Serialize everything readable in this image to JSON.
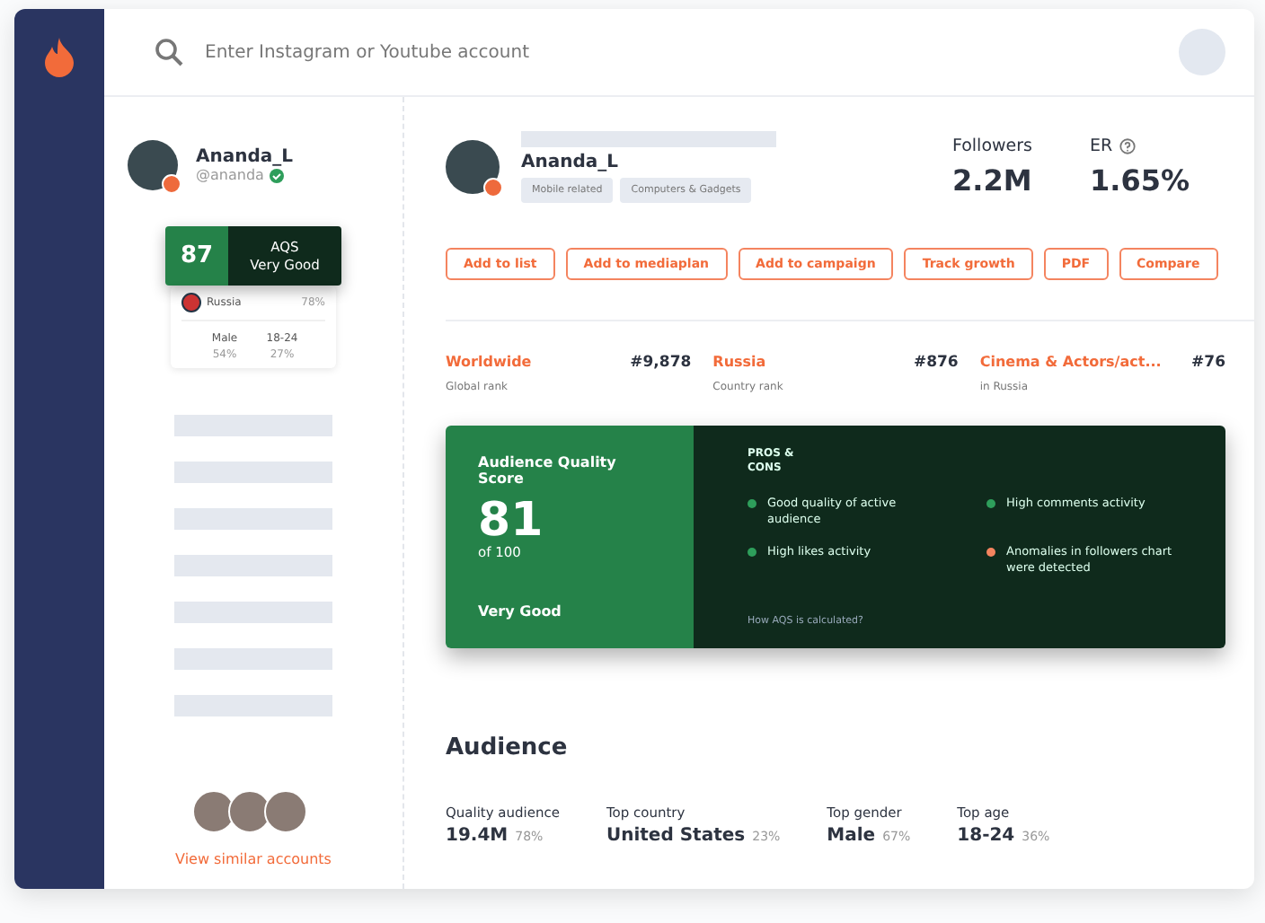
{
  "search": {
    "placeholder": "Enter Instagram or Youtube account"
  },
  "sidebar_profile": {
    "name": "Ananda_L",
    "handle": "@ananda",
    "verified": true,
    "aqs_score": "87",
    "aqs_label": "AQS",
    "aqs_rating": "Very Good",
    "country": "Russia",
    "country_share": "78%",
    "gender": "Male",
    "gender_share": "54%",
    "age": "18-24",
    "age_share": "27%"
  },
  "similar_link": "View similar accounts",
  "profile": {
    "name": "Ananda_L",
    "tags": [
      "Mobile related",
      "Computers & Gadgets"
    ],
    "followers_label": "Followers",
    "followers": "2.2M",
    "er_label": "ER",
    "er": "1.65%"
  },
  "actions": [
    "Add to list",
    "Add to mediaplan",
    "Add to campaign",
    "Track growth",
    "PDF",
    "Compare"
  ],
  "ranks": [
    {
      "category": "Worldwide",
      "rank": "#9,878",
      "caption": "Global rank"
    },
    {
      "category": "Russia",
      "rank": "#876",
      "caption": "Country rank"
    },
    {
      "category": "Cinema & Actors/act...",
      "rank": "#76",
      "caption": "in Russia"
    }
  ],
  "aqs": {
    "title": "Audience Quality Score",
    "score": "81",
    "scale": "of 100",
    "rating": "Very Good",
    "pros_cons_title": "PROS & CONS",
    "items": [
      {
        "text": "Good quality of active audience",
        "color": "#2e9e5b"
      },
      {
        "text": "High comments activity",
        "color": "#2e9e5b"
      },
      {
        "text": "High likes activity",
        "color": "#2e9e5b"
      },
      {
        "text": "Anomalies in followers chart were detected",
        "color": "#f4845f"
      }
    ],
    "help_link": "How AQS is calculated?"
  },
  "audience": {
    "title": "Audience",
    "stats": [
      {
        "label": "Quality audience",
        "value": "19.4M",
        "share": "78%"
      },
      {
        "label": "Top country",
        "value": "United States",
        "share": "23%"
      },
      {
        "label": "Top gender",
        "value": "Male",
        "share": "67%"
      },
      {
        "label": "Top age",
        "value": "18-24",
        "share": "36%"
      }
    ]
  }
}
